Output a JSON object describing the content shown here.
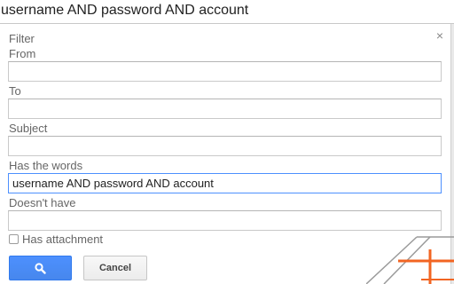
{
  "search": {
    "query": "username AND password AND account"
  },
  "filter": {
    "heading": "Filter",
    "close_icon": "close-icon",
    "from": {
      "label": "From",
      "value": ""
    },
    "to": {
      "label": "To",
      "value": ""
    },
    "subject": {
      "label": "Subject",
      "value": ""
    },
    "has_words": {
      "label": "Has the words",
      "value": "username AND password AND account"
    },
    "doesnt_have": {
      "label": "Doesn't have",
      "value": ""
    },
    "has_attachment": {
      "label": "Has attachment",
      "checked": false
    },
    "search_button_icon": "search-icon",
    "cancel_label": "Cancel"
  },
  "colors": {
    "accent_blue": "#4d90fe",
    "watermark_orange": "#f26522",
    "watermark_gray": "#9a9a9a"
  }
}
